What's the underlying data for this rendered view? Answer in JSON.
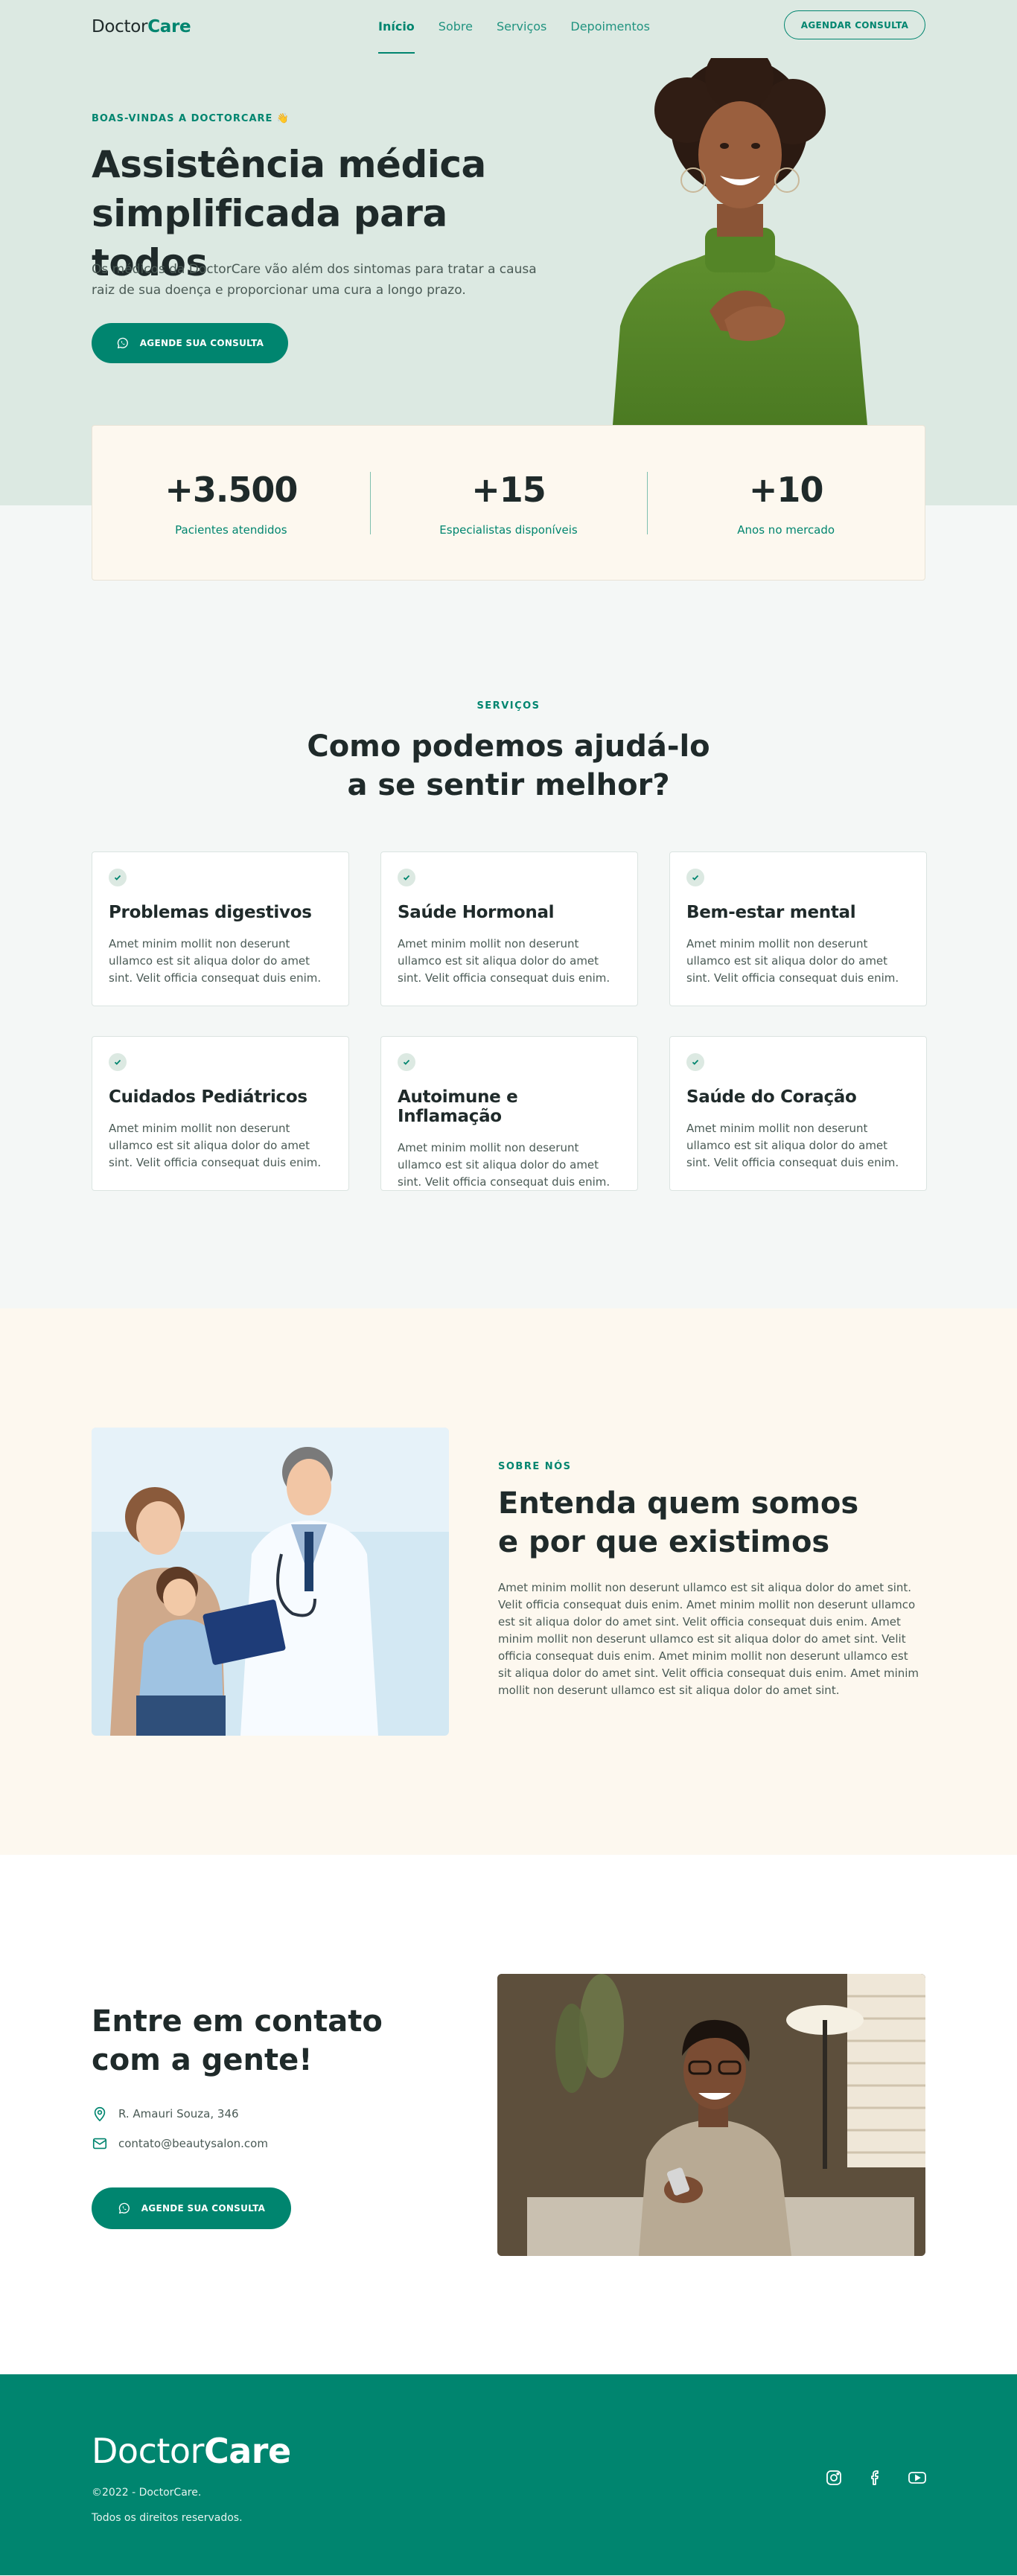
{
  "header": {
    "logo_part1": "Doctor",
    "logo_part2": "Care",
    "nav": [
      {
        "label": "Início",
        "active": true
      },
      {
        "label": "Sobre",
        "active": false
      },
      {
        "label": "Serviços",
        "active": false
      },
      {
        "label": "Depoimentos",
        "active": false
      }
    ],
    "cta_label": "AGENDAR CONSULTA"
  },
  "hero": {
    "tag": "BOAS-VINDAS A DOCTORCARE 👋",
    "title": "Assistência médica simplificada para todos",
    "description": "Os médicos da DoctorCare vão além dos sintomas para tratar a causa raiz de sua doença e proporcionar uma cura a longo prazo.",
    "button_label": "AGENDE SUA CONSULTA",
    "button_icon": "whatsapp-icon"
  },
  "stats": [
    {
      "value": "+3.500",
      "label": "Pacientes atendidos"
    },
    {
      "value": "+15",
      "label": "Especialistas disponíveis"
    },
    {
      "value": "+10",
      "label": "Anos no mercado"
    }
  ],
  "services": {
    "tag": "SERVIÇOS",
    "title_line1": "Como podemos ajudá-lo",
    "title_line2": "a se sentir melhor?",
    "cards": [
      {
        "title": "Problemas digestivos",
        "text": "Amet minim mollit non deserunt ullamco est sit aliqua dolor do amet sint. Velit officia consequat duis enim."
      },
      {
        "title": "Saúde Hormonal",
        "text": "Amet minim mollit non deserunt ullamco est sit aliqua dolor do amet sint. Velit officia consequat duis enim."
      },
      {
        "title": "Bem-estar mental",
        "text": "Amet minim mollit non deserunt ullamco est sit aliqua dolor do amet sint. Velit officia consequat duis enim."
      },
      {
        "title": "Cuidados Pediátricos",
        "text": "Amet minim mollit non deserunt ullamco est sit aliqua dolor do amet sint. Velit officia consequat duis enim."
      },
      {
        "title": "Autoimune e Inflamação",
        "text": "Amet minim mollit non deserunt ullamco est sit aliqua dolor do amet sint. Velit officia consequat duis enim."
      },
      {
        "title": "Saúde do Coração",
        "text": "Amet minim mollit non deserunt ullamco est sit aliqua dolor do amet sint. Velit officia consequat duis enim."
      }
    ]
  },
  "about": {
    "tag": "SOBRE NÓS",
    "title_line1": "Entenda quem somos",
    "title_line2": "e por que existimos",
    "text": "Amet minim mollit non deserunt ullamco est sit aliqua dolor do amet sint. Velit officia consequat duis enim. Amet minim mollit non deserunt ullamco est sit aliqua dolor do amet sint. Velit officia consequat duis enim. Amet minim mollit non deserunt ullamco est sit aliqua dolor do amet sint. Velit officia consequat duis enim. Amet minim mollit non deserunt ullamco est sit aliqua dolor do amet sint. Velit officia consequat duis enim. Amet minim mollit non deserunt ullamco est sit aliqua dolor do amet sint."
  },
  "contact": {
    "title_line1": "Entre em contato",
    "title_line2": "com a gente!",
    "address": "R. Amauri Souza, 346",
    "email": "contato@beautysalon.com",
    "button_label": "AGENDE SUA CONSULTA"
  },
  "footer": {
    "logo_part1": "Doctor",
    "logo_part2": "Care",
    "copyright": "©2022 - DoctorCare.",
    "rights": "Todos os direitos reservados.",
    "socials": [
      "instagram-icon",
      "facebook-icon",
      "youtube-icon"
    ]
  },
  "colors": {
    "brand": "#00856f",
    "hero_bg": "#dce9e2",
    "cream_bg": "#fdf8ef",
    "page_bg": "#f4f7f6"
  }
}
